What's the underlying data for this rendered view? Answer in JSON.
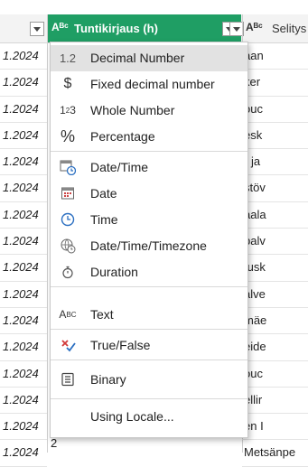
{
  "header": {
    "selected_column_type": "Aᴮᶜ",
    "selected_column_title": "Tuntikirjaus (h)",
    "right_column_type": "Aᴮᶜ",
    "right_column_title": "Selitys"
  },
  "left_cells": [
    "1.2024",
    "1.2024",
    "1.2024",
    "1.2024",
    "1.2024",
    "1.2024",
    "1.2024",
    "1.2024",
    "1.2024",
    "1.2024",
    "1.2024",
    "1.2024",
    "1.2024",
    "1.2024",
    "1.2024",
    "1.2024"
  ],
  "right_cells": [
    "aan",
    "ker",
    "ouc",
    "esk",
    "- ja",
    "stöv",
    "aala",
    "palv",
    "tusk",
    "alve",
    "mäe",
    "eide",
    "ouc",
    "ellir",
    "en I",
    "Metsänpe"
  ],
  "bottom_value": "2",
  "menu": {
    "items": [
      {
        "icon": "1.2",
        "label": "Decimal Number"
      },
      {
        "icon": "$",
        "label": "Fixed decimal number"
      },
      {
        "icon": "1²3",
        "label": "Whole Number"
      },
      {
        "icon": "%",
        "label": "Percentage"
      },
      {
        "icon": "date-time",
        "label": "Date/Time"
      },
      {
        "icon": "date",
        "label": "Date"
      },
      {
        "icon": "time",
        "label": "Time"
      },
      {
        "icon": "timezone",
        "label": "Date/Time/Timezone"
      },
      {
        "icon": "duration",
        "label": "Duration"
      },
      {
        "icon": "text",
        "label": "Text"
      },
      {
        "icon": "true-false",
        "label": "True/False"
      },
      {
        "icon": "binary",
        "label": "Binary"
      },
      {
        "icon": "",
        "label": "Using Locale..."
      }
    ]
  },
  "colors": {
    "accent": "#1f9e64",
    "highlight": "#e2e2e2",
    "calendar": "#2b6fc1"
  }
}
